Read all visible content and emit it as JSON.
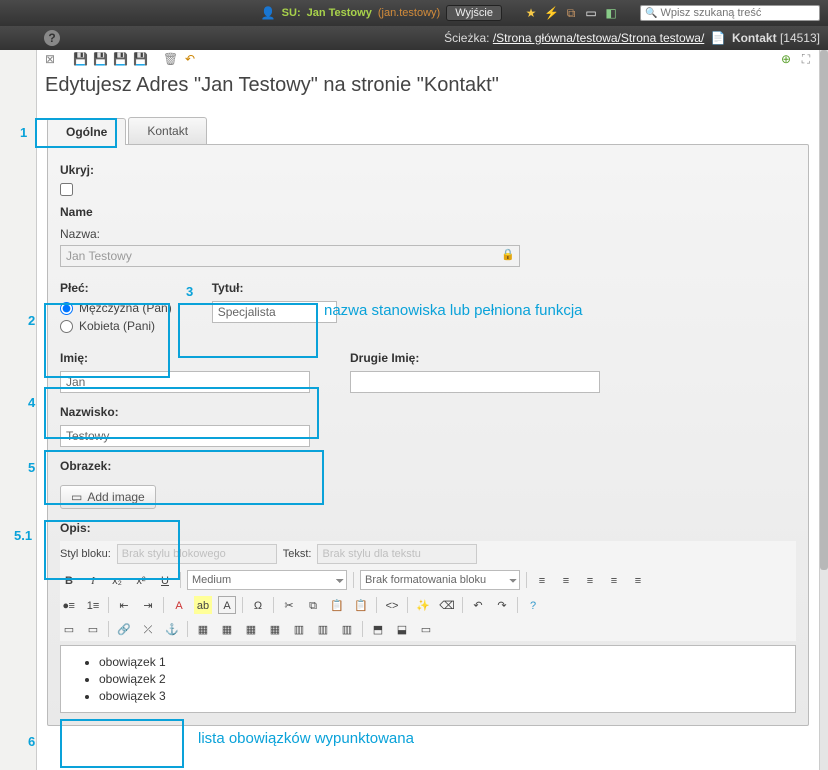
{
  "topbar": {
    "su_prefix": "SU:",
    "su_name": "Jan Testowy",
    "su_login": "(jan.testowy)",
    "logout": "Wyjście",
    "search_placeholder": "Wpisz szukaną treść"
  },
  "breadcrumb": {
    "label": "Ścieżka:",
    "path": "/Strona główna/testowa/Strona testowa/",
    "doc": "Kontakt",
    "docid": "[14513]"
  },
  "page_title": "Edytujesz Adres \"Jan Testowy\" na stronie \"Kontakt\"",
  "tabs": {
    "general": "Ogólne",
    "contact": "Kontakt"
  },
  "form": {
    "hide_label": "Ukryj:",
    "name_section": "Name",
    "nazwa_label": "Nazwa:",
    "nazwa_value": "Jan Testowy",
    "plec_label": "Płeć:",
    "plec_m": "Mężczyzna (Pan)",
    "plec_k": "Kobieta (Pani)",
    "tytul_label": "Tytuł:",
    "tytul_value": "Specjalista",
    "imie_label": "Imię:",
    "imie_value": "Jan",
    "drugie_label": "Drugie Imię:",
    "drugie_value": "",
    "nazwisko_label": "Nazwisko:",
    "nazwisko_value": "Testowy",
    "obrazek_label": "Obrazek:",
    "add_image": "Add image",
    "opis_label": "Opis:"
  },
  "editor": {
    "styl_bloku": "Styl bloku:",
    "styl_bloku_val": "Brak stylu blokowego",
    "tekst": "Tekst:",
    "tekst_val": "Brak stylu dla tekstu",
    "font_size": "Medium",
    "block_format": "Brak formatowania bloku",
    "items": [
      "obowiązek 1",
      "obowiązek 2",
      "obowiązek 3"
    ]
  },
  "annotations": {
    "n1": "1",
    "n2": "2",
    "n3": "3",
    "n3_text": "nazwa stanowiska lub pełniona funkcja",
    "n4": "4",
    "n5": "5",
    "n51": "5.1",
    "n6": "6",
    "n6_text": "lista obowiązków wypunktowana"
  }
}
